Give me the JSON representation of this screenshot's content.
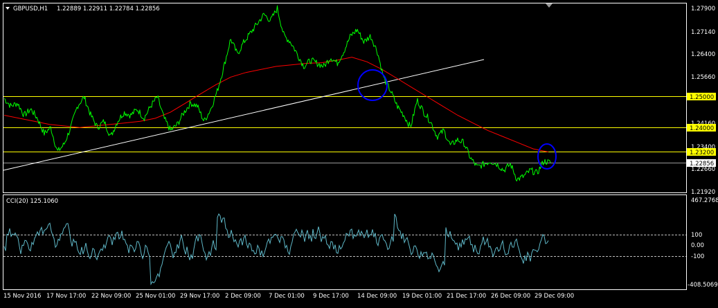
{
  "chart_header": {
    "symbol_label": "GBPUSD,H1",
    "ohlc": "1.22889 1.22911 1.22784 1.22856"
  },
  "price_axis": {
    "ticks": [
      "1.27900",
      "1.27140",
      "1.26400",
      "1.25660",
      "1.25000",
      "1.24160",
      "1.24000",
      "1.23400",
      "1.23200",
      "1.22856",
      "1.22660",
      "1.21920"
    ],
    "highlighted_labels": [
      "1.25000",
      "1.24000",
      "1.23200"
    ],
    "current_price_label": "1.22856"
  },
  "horizontal_levels": [
    {
      "label": "1.25000",
      "price": 1.25,
      "color": "#ffff00"
    },
    {
      "label": "1.24000",
      "price": 1.24,
      "color": "#ffff00"
    },
    {
      "label": "1.23200",
      "price": 1.232,
      "color": "#ffff00"
    }
  ],
  "indicator": {
    "label": "CCI(20) 125.1060",
    "ticks": [
      "467.2768",
      "100",
      "0.00",
      "-100",
      "-408.5069"
    ],
    "color": "#5fb8c8"
  },
  "time_axis": {
    "labels": [
      "15 Nov 2016",
      "17 Nov 17:00",
      "22 Nov 09:00",
      "25 Nov 01:00",
      "29 Nov 17:00",
      "2 Dec 09:00",
      "7 Dec 01:00",
      "9 Dec 17:00",
      "14 Dec 09:00",
      "19 Dec 01:00",
      "21 Dec 17:00",
      "26 Dec 09:00",
      "29 Dec 09:00"
    ]
  },
  "colors": {
    "price_line": "#00ff00",
    "moving_average": "#ff0000",
    "trendline": "#ffffff",
    "levels": "#ffff00",
    "circles": "#0000ff",
    "cci_line": "#5fb8c8",
    "background": "#000000"
  },
  "chart_data": {
    "type": "line",
    "series": [
      {
        "values": [
          1.2495,
          1.247,
          1.248,
          1.244,
          1.246,
          1.243,
          1.238,
          1.24,
          1.232,
          1.2345,
          1.24,
          1.247,
          1.25,
          1.244,
          1.24,
          1.242,
          1.237,
          1.242,
          1.245,
          1.244,
          1.246,
          1.243,
          1.247,
          1.25,
          1.243,
          1.239,
          1.241,
          1.245,
          1.248,
          1.247,
          1.242,
          1.246,
          1.252,
          1.26,
          1.269,
          1.264,
          1.268,
          1.271,
          1.274,
          1.277,
          1.275,
          1.279,
          1.27,
          1.268,
          1.264,
          1.26,
          1.262,
          1.261,
          1.26,
          1.263,
          1.261,
          1.265,
          1.27,
          1.272,
          1.268,
          1.27,
          1.265,
          1.256,
          1.252,
          1.247,
          1.244,
          1.24,
          1.249,
          1.245,
          1.242,
          1.237,
          1.239,
          1.234,
          1.236,
          1.235,
          1.23,
          1.227,
          1.228,
          1.229,
          1.228,
          1.226,
          1.228,
          1.223,
          1.224,
          1.226,
          1.225,
          1.229,
          1.2285
        ]
      },
      {
        "values": [
          1.244,
          1.243,
          1.242,
          1.241,
          1.2405,
          1.24,
          1.2405,
          1.241,
          1.2415,
          1.242,
          1.243,
          1.245,
          1.248,
          1.251,
          1.254,
          1.2565,
          1.258,
          1.259,
          1.26,
          1.2605,
          1.261,
          1.2612,
          1.262,
          1.263,
          1.2615,
          1.259,
          1.256,
          1.253,
          1.25,
          1.247,
          1.244,
          1.2415,
          1.239,
          1.237,
          1.235,
          1.233,
          1.232
        ]
      }
    ],
    "ylim": [
      1.2192,
      1.279
    ]
  }
}
